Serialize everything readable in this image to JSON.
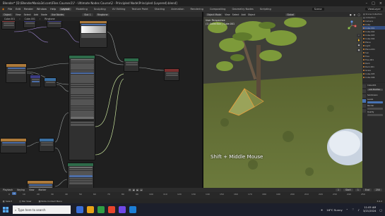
{
  "window": {
    "title": "Blender* [D:\\BlenderMania3d.com\\Files Courses1\\? - Ultimate Nodes Course\\2 - Principled Node\\Principled (Layered).blend]",
    "controls": [
      "–",
      "□",
      "×"
    ]
  },
  "menu": {
    "items": [
      "File",
      "Edit",
      "Render",
      "Window",
      "Help"
    ],
    "workspaces": [
      "Layout",
      "Modeling",
      "Sculpting",
      "UV Editing",
      "Texture Paint",
      "Shading",
      "Animation",
      "Rendering",
      "Compositing",
      "Geometry Nodes",
      "Scripting"
    ],
    "active_workspace": "Layout",
    "scene": "Scene",
    "view_layer": "ViewLayer"
  },
  "node_editor": {
    "header": [
      "Object",
      "View",
      "Select",
      "Add",
      "Node",
      "Use Nodes"
    ],
    "slot": "Slot 1",
    "material": "Ringtone",
    "breadcrumb": [
      "Cube.001",
      "Cube.001",
      "Ringtone"
    ]
  },
  "viewport": {
    "header": [
      "Object Mode",
      "View",
      "Select",
      "Add",
      "Object"
    ],
    "global": "Global",
    "info_line1": "User Perspective",
    "info_line2": "(1) Collection | Cube.001",
    "shortcut_overlay": "Shift + Middle Mouse",
    "gizmo_axes": [
      "X",
      "Y",
      "Z"
    ]
  },
  "outliner": {
    "rows": [
      "Scene Collection",
      "Collection",
      "Camera",
      "Cube",
      "Cube.001",
      "Cube.002",
      "Cube.003",
      "Cube.004",
      "Plane",
      "Light",
      "Plane.001",
      "Sun",
      "Tree",
      "Tree.001",
      "Rock",
      "Rock.001",
      "Grass",
      "Cube.005",
      "Cube.006"
    ]
  },
  "properties": {
    "labels": [
      "Cube.001",
      "Add Modifier",
      "Subdivision",
      "Levels",
      "Render",
      "Quality"
    ]
  },
  "timeline": {
    "menu": [
      "Playback",
      "Keying",
      "View",
      "Marker"
    ],
    "play_buttons": [
      "⏮",
      "◀",
      "▶",
      "⏭"
    ],
    "current_frame": "1",
    "start_label": "Start",
    "start": "1",
    "end_label": "End",
    "end": "250",
    "ticks": [
      "0",
      "10",
      "20",
      "30",
      "40",
      "50",
      "60",
      "70",
      "80",
      "90",
      "100",
      "110",
      "120",
      "130",
      "140",
      "150",
      "160",
      "170",
      "180",
      "190",
      "200",
      "210",
      "220",
      "230",
      "240",
      "250"
    ]
  },
  "statusbar": {
    "items": [
      "Select",
      "Pan View",
      "Node Context Menu"
    ],
    "version": "3.6.2"
  },
  "taskbar": {
    "search_placeholder": "Type here to search",
    "weather": "16°C Sunny",
    "time": "11:05 AM",
    "date": "3/21/2024",
    "app_colors": [
      "#3a6fd8",
      "#e8a317",
      "#2f9e44",
      "#e8452c",
      "#7048e8",
      "#1c7ed6"
    ]
  },
  "colors": {
    "accent": "#4772b3",
    "node_header_shader": "#2e6b4a",
    "node_header_texture": "#ad7a3a",
    "node_header_vector": "#3c3c83",
    "node_header_converter": "#3a6fa2",
    "node_header_output": "#7a2f2f"
  }
}
